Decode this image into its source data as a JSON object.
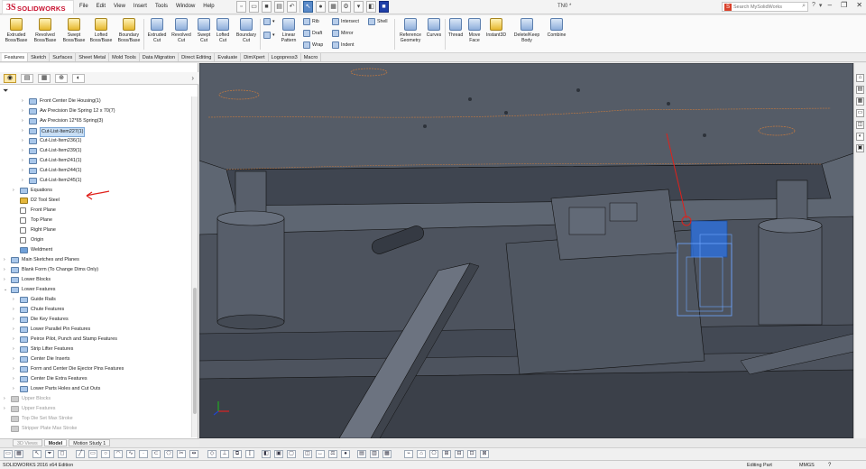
{
  "app": {
    "logo_mark": "3S",
    "logo_text": "SOLIDWORKS",
    "document_title": "TN0 *",
    "search_placeholder": "Search MySolidWorks"
  },
  "menu": [
    "File",
    "Edit",
    "View",
    "Insert",
    "Tools",
    "Window",
    "Help"
  ],
  "ribbon": {
    "buttons": [
      {
        "label1": "Extruded",
        "label2": "Boss/Base",
        "icon": "extruded-boss-icon"
      },
      {
        "label1": "Revolved",
        "label2": "Boss/Base",
        "icon": "revolved-boss-icon"
      },
      {
        "label1": "Swept",
        "label2": "Boss/Base",
        "icon": "swept-boss-icon"
      },
      {
        "label1": "Lofted",
        "label2": "Boss/Base",
        "icon": "lofted-boss-icon"
      },
      {
        "label1": "Boundary",
        "label2": "Boss/Base",
        "icon": "boundary-boss-icon"
      },
      {
        "label1": "Extruded",
        "label2": "Cut",
        "icon": "extruded-cut-icon"
      },
      {
        "label1": "Revolved",
        "label2": "Cut",
        "icon": "revolved-cut-icon"
      },
      {
        "label1": "Swept",
        "label2": "Cut",
        "icon": "swept-cut-icon"
      },
      {
        "label1": "Lofted",
        "label2": "Cut",
        "icon": "lofted-cut-icon"
      },
      {
        "label1": "Boundary",
        "label2": "Cut",
        "icon": "boundary-cut-icon"
      }
    ],
    "linear_pattern": [
      "Linear",
      "Pattern"
    ],
    "small": [
      "Rib",
      "Draft",
      "Wrap",
      "Intersect",
      "Mirror",
      "Indent",
      "Shell"
    ],
    "right_buttons": [
      {
        "label1": "Reference",
        "label2": "Geometry"
      },
      {
        "label1": "Curves",
        "label2": ""
      },
      {
        "label1": "Thread",
        "label2": ""
      },
      {
        "label1": "Move",
        "label2": "Face"
      },
      {
        "label1": "Instant3D",
        "label2": ""
      },
      {
        "label1": "Delete/Keep",
        "label2": "Body"
      },
      {
        "label1": "Combine",
        "label2": ""
      }
    ]
  },
  "tabs": [
    "Features",
    "Sketch",
    "Surfaces",
    "Sheet Metal",
    "Mold Tools",
    "Data Migration",
    "Direct Editing",
    "Evaluate",
    "DimXpert",
    "Logopress3",
    "Macro"
  ],
  "tree": [
    {
      "label": "Front Center Die Housing(1)",
      "indent": 2,
      "icon": "folder",
      "exp": "›"
    },
    {
      "label": "Aw Precision Die Spring 12 x 70(7)",
      "indent": 2,
      "icon": "folder",
      "exp": "›"
    },
    {
      "label": "Aw Precision 12*65 Spring(3)",
      "indent": 2,
      "icon": "folder",
      "exp": "›"
    },
    {
      "label": "Cut-List-Item227(1)",
      "indent": 2,
      "icon": "folder",
      "exp": "›",
      "selected": true
    },
    {
      "label": "Cut-List-Item236(1)",
      "indent": 2,
      "icon": "folder",
      "exp": "›"
    },
    {
      "label": "Cut-List-Item239(1)",
      "indent": 2,
      "icon": "folder",
      "exp": "›"
    },
    {
      "label": "Cut-List-Item241(1)",
      "indent": 2,
      "icon": "folder",
      "exp": "›"
    },
    {
      "label": "Cut-List-Item244(1)",
      "indent": 2,
      "icon": "folder",
      "exp": "›"
    },
    {
      "label": "Cut-List-Item245(1)",
      "indent": 2,
      "icon": "folder",
      "exp": "›"
    },
    {
      "label": "Equations",
      "indent": 1,
      "icon": "folder",
      "exp": "›"
    },
    {
      "label": "D2 Tool Steel",
      "indent": 1,
      "icon": "mat",
      "exp": ""
    },
    {
      "label": "Front Plane",
      "indent": 1,
      "icon": "plane",
      "exp": ""
    },
    {
      "label": "Top Plane",
      "indent": 1,
      "icon": "plane",
      "exp": ""
    },
    {
      "label": "Right Plane",
      "indent": 1,
      "icon": "plane",
      "exp": ""
    },
    {
      "label": "Origin",
      "indent": 1,
      "icon": "origin",
      "exp": ""
    },
    {
      "label": "Weldment",
      "indent": 1,
      "icon": "feat",
      "exp": ""
    },
    {
      "label": "Main Sketches and Planes",
      "indent": 0,
      "icon": "folder",
      "exp": "›"
    },
    {
      "label": "Blank Form (To Change Dims Only)",
      "indent": 0,
      "icon": "folder",
      "exp": "›"
    },
    {
      "label": "Lower Blocks",
      "indent": 0,
      "icon": "folder",
      "exp": "›"
    },
    {
      "label": "Lower Features",
      "indent": 0,
      "icon": "folder",
      "exp": "⌄"
    },
    {
      "label": "Guide Rails",
      "indent": 1,
      "icon": "folder",
      "exp": "›"
    },
    {
      "label": "Chute Features",
      "indent": 1,
      "icon": "folder",
      "exp": "›"
    },
    {
      "label": "Die Key Features",
      "indent": 1,
      "icon": "folder",
      "exp": "›"
    },
    {
      "label": "Lower Parallel Pin Features",
      "indent": 1,
      "icon": "folder",
      "exp": "›"
    },
    {
      "label": "Peirce Pilot, Punch and Stamp  Features",
      "indent": 1,
      "icon": "folder",
      "exp": "›"
    },
    {
      "label": "Strip Lifter Features",
      "indent": 1,
      "icon": "folder",
      "exp": "›"
    },
    {
      "label": "Center Die Inserts",
      "indent": 1,
      "icon": "folder",
      "exp": "›"
    },
    {
      "label": "Form and Center Die Ejector Pins Features",
      "indent": 1,
      "icon": "folder",
      "exp": "›"
    },
    {
      "label": "Center Die Extra Features",
      "indent": 1,
      "icon": "folder",
      "exp": "›"
    },
    {
      "label": "Lower Parts Holes and Cut Outs",
      "indent": 1,
      "icon": "folder",
      "exp": "›"
    },
    {
      "label": "Upper Blocks",
      "indent": 0,
      "icon": "folder",
      "exp": "›",
      "gray": true
    },
    {
      "label": "Upper Features",
      "indent": 0,
      "icon": "folder",
      "exp": "›",
      "gray": true
    },
    {
      "label": "Top Die Set Max Stroke",
      "indent": 0,
      "icon": "feat",
      "exp": "",
      "gray": true
    },
    {
      "label": "Stripper Plate Max Stroke",
      "indent": 0,
      "icon": "feat",
      "exp": "",
      "gray": true
    }
  ],
  "bottom_tabs": {
    "dim": "3D Views",
    "model": "Model",
    "motion": "Motion Study 1"
  },
  "status": {
    "edition": "SOLIDWORKS 2016 x64 Edition",
    "mode": "Editing Part",
    "units": "MMGS",
    "help": "?"
  },
  "colors": {
    "viewport_bg": "#5e6672",
    "model_fill": "#4a505b",
    "selection_blue": "#2f6fd6",
    "annotation_red": "#e0211b",
    "accent_red": "#c8102e"
  }
}
